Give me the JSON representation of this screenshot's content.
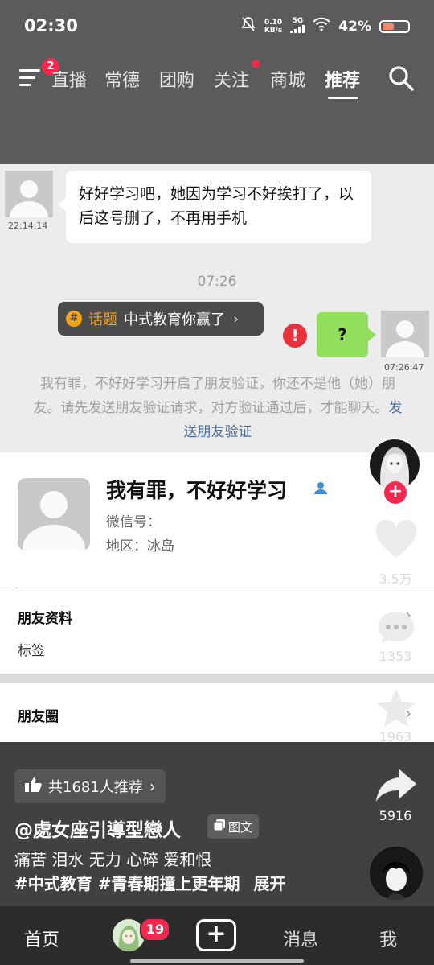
{
  "status_bar": {
    "time": "02:30",
    "net_speed_top": "0.10",
    "net_speed_bottom": "KB/s",
    "network": "5G",
    "battery": "42%"
  },
  "top_nav": {
    "menu_badge": "2",
    "tabs": [
      "直播",
      "常德",
      "团购",
      "关注",
      "商城",
      "推荐"
    ],
    "active_tab": "推荐"
  },
  "chat": {
    "incoming_text": "好好学习吧，她因为学习不好挨打了，以后这号删了，不再用手机",
    "incoming_time": "22:14:14",
    "center_time": "07:26",
    "topic_label": "话题",
    "topic_text": "中式教育你赢了",
    "error_mark": "!",
    "outgoing_text": "?",
    "outgoing_time": "07:26:47",
    "system_message": "我有罪，不好好学习开启了朋友验证，你还不是他（她）朋友。请先发送朋友验证请求，对方验证通过后，才能聊天。",
    "system_link": "发送朋友验证"
  },
  "profile": {
    "name": "我有罪，不好好学习",
    "wechat_id": "微信号：",
    "region": "地区：冰岛",
    "rows": {
      "friend_info": "朋友资料",
      "tags": "标签",
      "moments": "朋友圈"
    }
  },
  "rail": {
    "follow_plus": "+",
    "likes": "3.5万",
    "comments": "1353",
    "favorites": "1963",
    "shares": "5916"
  },
  "post": {
    "recommend": "共1681人推荐",
    "author": "@處女座引導型戀人",
    "type_tag": "图文",
    "description": "痛苦 泪水 无力 心碎 爱和恨",
    "hashtags": "#中式教育 #青春期撞上更年期",
    "expand": "展开"
  },
  "bottom_tabs": {
    "home": "首页",
    "friends_badge": "19",
    "plus": "+",
    "messages": "消息",
    "me": "我"
  },
  "colors": {
    "accent_red": "#f5294f",
    "wechat_green": "#93e05f",
    "topic_orange": "#f7a41b",
    "link_blue": "#4a6a98"
  }
}
